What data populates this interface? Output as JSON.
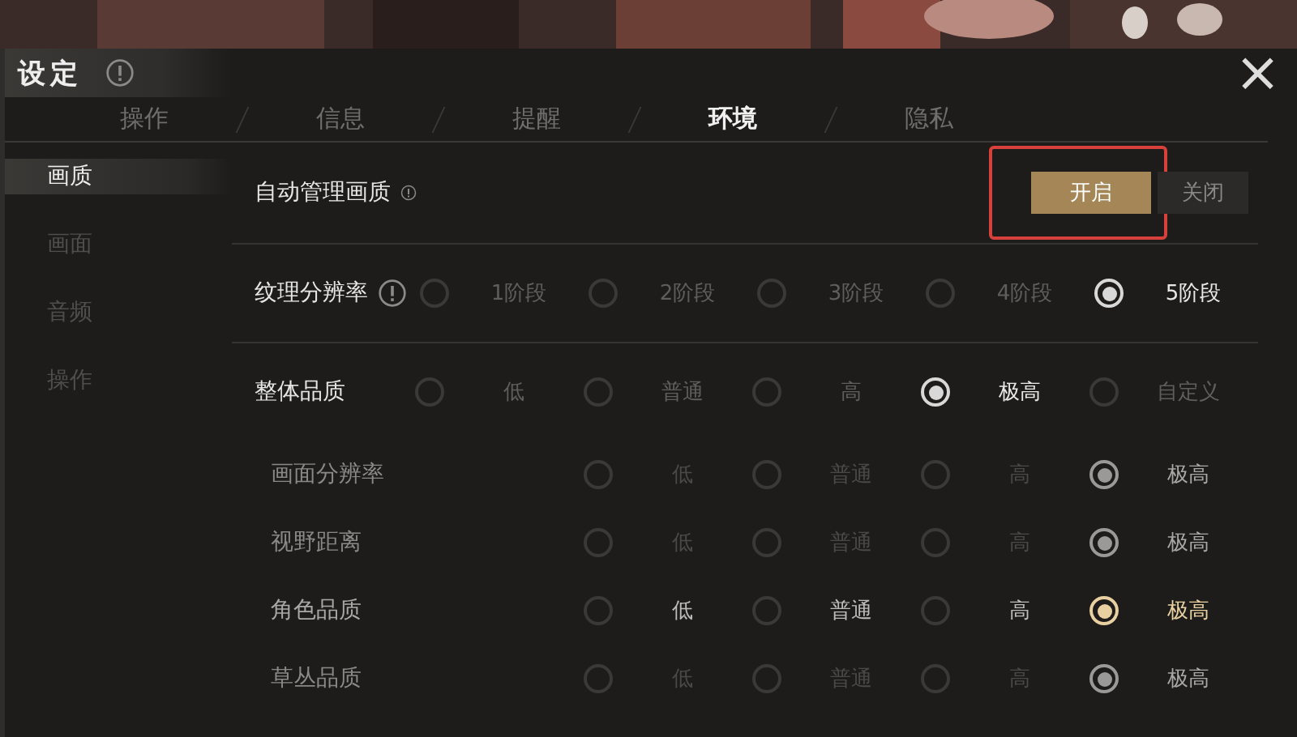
{
  "window": {
    "title": "设定",
    "close": "×"
  },
  "tabs": [
    {
      "label": "操作",
      "selected": false
    },
    {
      "label": "信息",
      "selected": false
    },
    {
      "label": "提醒",
      "selected": false
    },
    {
      "label": "环境",
      "selected": true
    },
    {
      "label": "隐私",
      "selected": false
    }
  ],
  "sidebar": {
    "items": [
      {
        "label": "画质",
        "selected": true
      },
      {
        "label": "画面",
        "selected": false
      },
      {
        "label": "音频",
        "selected": false
      },
      {
        "label": "操作",
        "selected": false
      }
    ]
  },
  "settings": [
    {
      "kind": "toggle",
      "label": "自动管理画质",
      "info": true,
      "highlighted": true,
      "options": [
        {
          "label": "开启",
          "selected": true
        },
        {
          "label": "关闭",
          "selected": false
        }
      ]
    },
    {
      "kind": "radio",
      "label": "纹理分辨率",
      "info": true,
      "sub": false,
      "disabled": false,
      "options": [
        {
          "label": "1阶段",
          "selected": false
        },
        {
          "label": "2阶段",
          "selected": false
        },
        {
          "label": "3阶段",
          "selected": false
        },
        {
          "label": "4阶段",
          "selected": false
        },
        {
          "label": "5阶段",
          "selected": true
        }
      ]
    },
    {
      "kind": "radio",
      "label": "整体品质",
      "info": false,
      "sub": false,
      "disabled": false,
      "options": [
        {
          "label": "低",
          "selected": false
        },
        {
          "label": "普通",
          "selected": false
        },
        {
          "label": "高",
          "selected": false
        },
        {
          "label": "极高",
          "selected": true
        },
        {
          "label": "自定义",
          "selected": false
        }
      ]
    },
    {
      "kind": "radio",
      "label": "画面分辨率",
      "info": false,
      "sub": true,
      "disabled": true,
      "options": [
        {
          "label": "低",
          "selected": false
        },
        {
          "label": "普通",
          "selected": false
        },
        {
          "label": "高",
          "selected": false
        },
        {
          "label": "极高",
          "selected": true
        }
      ]
    },
    {
      "kind": "radio",
      "label": "视野距离",
      "info": false,
      "sub": true,
      "disabled": true,
      "options": [
        {
          "label": "低",
          "selected": false
        },
        {
          "label": "普通",
          "selected": false
        },
        {
          "label": "高",
          "selected": false
        },
        {
          "label": "极高",
          "selected": true
        }
      ]
    },
    {
      "kind": "radio",
      "label": "角色品质",
      "info": false,
      "sub": true,
      "disabled": false,
      "options": [
        {
          "label": "低",
          "selected": false
        },
        {
          "label": "普通",
          "selected": false
        },
        {
          "label": "高",
          "selected": false
        },
        {
          "label": "极高",
          "selected": true
        }
      ]
    },
    {
      "kind": "radio",
      "label": "草丛品质",
      "info": false,
      "sub": true,
      "disabled": true,
      "options": [
        {
          "label": "低",
          "selected": false
        },
        {
          "label": "普通",
          "selected": false
        },
        {
          "label": "高",
          "selected": false
        },
        {
          "label": "极高",
          "selected": true
        }
      ]
    }
  ]
}
